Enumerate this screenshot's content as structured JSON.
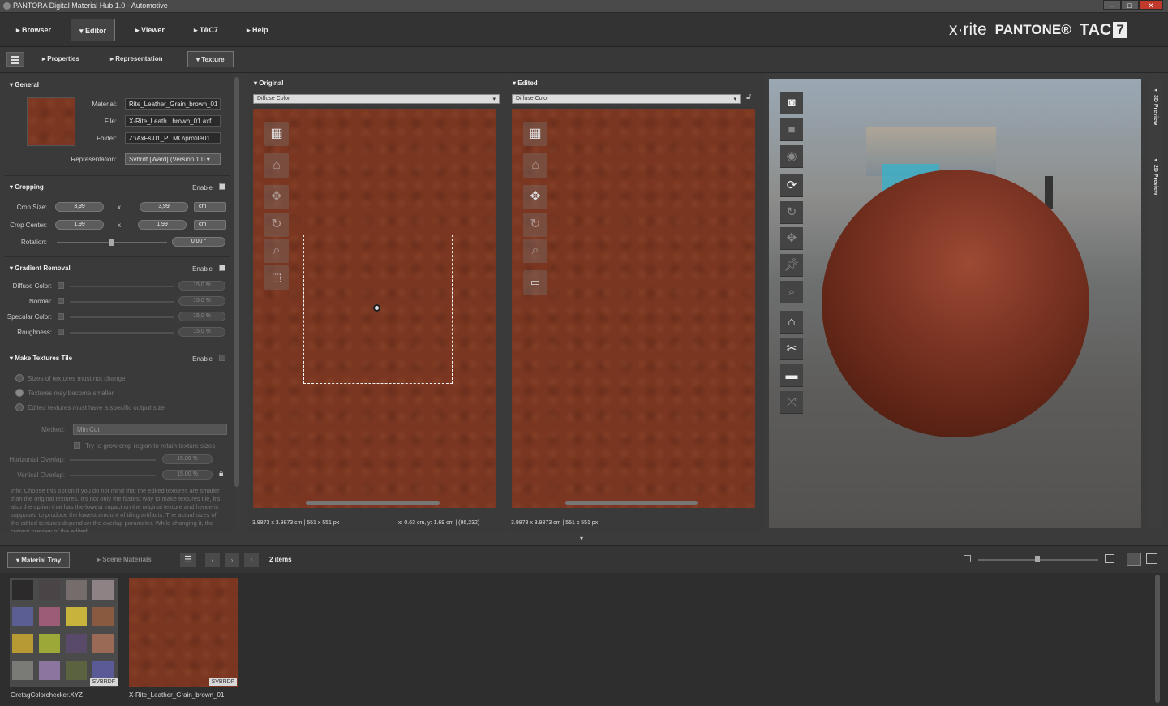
{
  "window": {
    "title": "PANTORA Digital Material Hub 1.0 - Automotive",
    "min": "–",
    "max": "□",
    "close": "✕"
  },
  "nav": {
    "tabs": [
      "▸ Browser",
      "▾ Editor",
      "▸ Viewer",
      "▸ TAC7",
      "▸ Help"
    ],
    "active_index": 1
  },
  "brand": {
    "xrite": "x·rite",
    "pantone": "PANTONE®",
    "tac": "TAC",
    "tac_num": "7"
  },
  "subnav": {
    "tabs": [
      "▸ Properties",
      "▸ Representation",
      "▾ Texture"
    ],
    "active_index": 2
  },
  "general": {
    "title": "▾ General",
    "material_label": "Material:",
    "material_value": "Rite_Leather_Grain_brown_01",
    "file_label": "File:",
    "file_value": "X-Rite_Leath...brown_01.axf",
    "folder_label": "Folder:",
    "folder_value": "Z:\\AxFs\\01_P...MO\\profile01",
    "representation_label": "Representation:",
    "representation_value": "Svbrdf [Ward] (Version 1.0 ▾"
  },
  "cropping": {
    "title": "▾ Cropping",
    "enable": "Enable",
    "crop_size_label": "Crop Size:",
    "crop_size_x": "3,99",
    "crop_size_y": "3,99",
    "times": "x",
    "unit": "cm",
    "crop_center_label": "Crop Center:",
    "crop_center_x": "1,99",
    "crop_center_y": "1,99",
    "rotation_label": "Rotation:",
    "rotation_value": "0,00 °"
  },
  "gradient": {
    "title": "▾ Gradient Removal",
    "enable": "Enable",
    "rows": [
      {
        "label": "Diffuse Color:",
        "value": "15,0 %"
      },
      {
        "label": "Normal:",
        "value": "15,0 %"
      },
      {
        "label": "Specular Color:",
        "value": "15,0 %"
      },
      {
        "label": "Roughness:",
        "value": "15,0 %"
      }
    ]
  },
  "tiles": {
    "title": "▾ Make Textures Tile",
    "enable": "Enable",
    "options": [
      "Sizes of textures must not change",
      "Textures may become smaller",
      "Edited textures must have a specific output size"
    ],
    "method_label": "Method:",
    "method_value": "Min Cut",
    "grow_label": "Try to grow crop region to retain texture sizes",
    "h_overlap_label": "Horizontal Overlap:",
    "h_overlap_value": "15,00 %",
    "v_overlap_label": "Vertical Overlap:",
    "v_overlap_value": "15,00 %",
    "info": "Info: Choose this option if you do not mind that the edited textures are smaller than the original textures. It's not only the fastest way to make textures tile, it's also the option that has the lowest impact on the original texture and hence is supposed to produce the lowest amount of tiling artifacts. The actual sizes of the edited textures depend on the overlap parameter. While changing it, the current preview of the edited"
  },
  "original": {
    "title": "▾ Original",
    "channel": "Diffuse Color",
    "status_left": "3.9873 x 3.9873 cm | 551 x 551 px",
    "status_right": "x: 0.63 cm, y: 1.69 cm | (86,232)"
  },
  "edited": {
    "title": "▾ Edited",
    "channel": "Diffuse Color",
    "status_left": "3.9873 x 3.9873 cm | 551 x 551 px"
  },
  "side_tabs": [
    "◂ 3D Preview",
    "◂ 2D Preview"
  ],
  "bottom": {
    "tabs": [
      "▾ Material Tray",
      "▸ Scene Materials"
    ],
    "count": "2 items"
  },
  "tray": {
    "items": [
      {
        "name": "GretagColorchecker.XYZ",
        "badge": "SVBRDF"
      },
      {
        "name": "X-Rite_Leather_Grain_brown_01",
        "badge": "SVBRDF"
      }
    ],
    "checker_colors": [
      "#2c2a2a",
      "#4a4446",
      "#756c6c",
      "#8e8284",
      "#5a5e92",
      "#9c5c78",
      "#c8b43c",
      "#8a5a40",
      "#b89a34",
      "#9ca838",
      "#5a4a6a",
      "#9a6a56",
      "#7a7a76",
      "#8c76a0",
      "#5a6240",
      "#5a5a96"
    ]
  },
  "icons": {
    "grid": "grid-icon",
    "home": "home-icon",
    "move": "move-icon",
    "rotate": "rotate-icon",
    "zoom": "zoom-icon",
    "crop": "crop-icon",
    "camera": "camera-icon"
  }
}
